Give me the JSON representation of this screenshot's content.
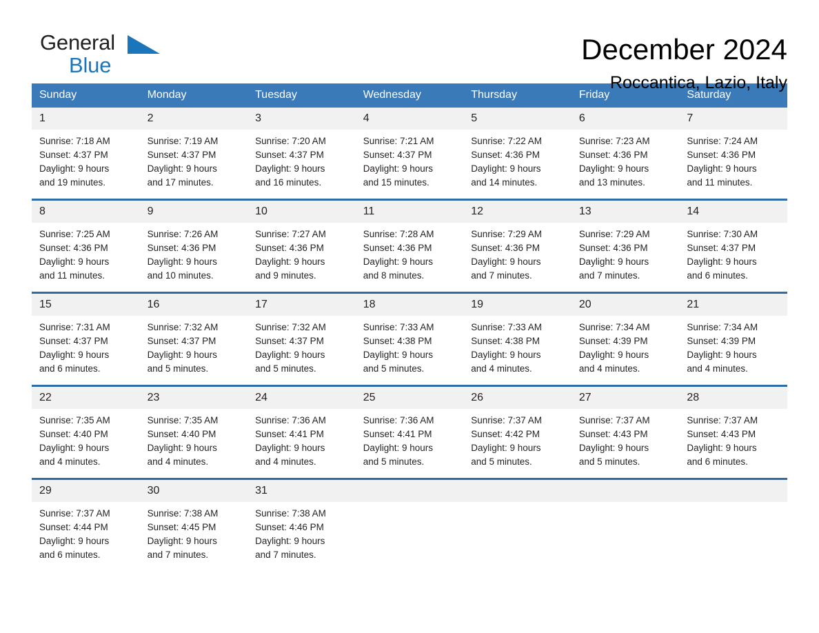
{
  "brand": {
    "name_part1": "General",
    "name_part2": "Blue",
    "triangle_color": "#1b75bb"
  },
  "header": {
    "title": "December 2024",
    "subtitle": "Roccantica, Lazio, Italy"
  },
  "theme": {
    "header_bg": "#3a7ab8",
    "rule_color": "#2b6ca9",
    "daynum_bg": "#f1f1f1",
    "text_color": "#231f20"
  },
  "weekdays": [
    "Sunday",
    "Monday",
    "Tuesday",
    "Wednesday",
    "Thursday",
    "Friday",
    "Saturday"
  ],
  "weeks": [
    [
      {
        "day": "1",
        "sunrise": "Sunrise: 7:18 AM",
        "sunset": "Sunset: 4:37 PM",
        "daylight1": "Daylight: 9 hours",
        "daylight2": "and 19 minutes."
      },
      {
        "day": "2",
        "sunrise": "Sunrise: 7:19 AM",
        "sunset": "Sunset: 4:37 PM",
        "daylight1": "Daylight: 9 hours",
        "daylight2": "and 17 minutes."
      },
      {
        "day": "3",
        "sunrise": "Sunrise: 7:20 AM",
        "sunset": "Sunset: 4:37 PM",
        "daylight1": "Daylight: 9 hours",
        "daylight2": "and 16 minutes."
      },
      {
        "day": "4",
        "sunrise": "Sunrise: 7:21 AM",
        "sunset": "Sunset: 4:37 PM",
        "daylight1": "Daylight: 9 hours",
        "daylight2": "and 15 minutes."
      },
      {
        "day": "5",
        "sunrise": "Sunrise: 7:22 AM",
        "sunset": "Sunset: 4:36 PM",
        "daylight1": "Daylight: 9 hours",
        "daylight2": "and 14 minutes."
      },
      {
        "day": "6",
        "sunrise": "Sunrise: 7:23 AM",
        "sunset": "Sunset: 4:36 PM",
        "daylight1": "Daylight: 9 hours",
        "daylight2": "and 13 minutes."
      },
      {
        "day": "7",
        "sunrise": "Sunrise: 7:24 AM",
        "sunset": "Sunset: 4:36 PM",
        "daylight1": "Daylight: 9 hours",
        "daylight2": "and 11 minutes."
      }
    ],
    [
      {
        "day": "8",
        "sunrise": "Sunrise: 7:25 AM",
        "sunset": "Sunset: 4:36 PM",
        "daylight1": "Daylight: 9 hours",
        "daylight2": "and 11 minutes."
      },
      {
        "day": "9",
        "sunrise": "Sunrise: 7:26 AM",
        "sunset": "Sunset: 4:36 PM",
        "daylight1": "Daylight: 9 hours",
        "daylight2": "and 10 minutes."
      },
      {
        "day": "10",
        "sunrise": "Sunrise: 7:27 AM",
        "sunset": "Sunset: 4:36 PM",
        "daylight1": "Daylight: 9 hours",
        "daylight2": "and 9 minutes."
      },
      {
        "day": "11",
        "sunrise": "Sunrise: 7:28 AM",
        "sunset": "Sunset: 4:36 PM",
        "daylight1": "Daylight: 9 hours",
        "daylight2": "and 8 minutes."
      },
      {
        "day": "12",
        "sunrise": "Sunrise: 7:29 AM",
        "sunset": "Sunset: 4:36 PM",
        "daylight1": "Daylight: 9 hours",
        "daylight2": "and 7 minutes."
      },
      {
        "day": "13",
        "sunrise": "Sunrise: 7:29 AM",
        "sunset": "Sunset: 4:36 PM",
        "daylight1": "Daylight: 9 hours",
        "daylight2": "and 7 minutes."
      },
      {
        "day": "14",
        "sunrise": "Sunrise: 7:30 AM",
        "sunset": "Sunset: 4:37 PM",
        "daylight1": "Daylight: 9 hours",
        "daylight2": "and 6 minutes."
      }
    ],
    [
      {
        "day": "15",
        "sunrise": "Sunrise: 7:31 AM",
        "sunset": "Sunset: 4:37 PM",
        "daylight1": "Daylight: 9 hours",
        "daylight2": "and 6 minutes."
      },
      {
        "day": "16",
        "sunrise": "Sunrise: 7:32 AM",
        "sunset": "Sunset: 4:37 PM",
        "daylight1": "Daylight: 9 hours",
        "daylight2": "and 5 minutes."
      },
      {
        "day": "17",
        "sunrise": "Sunrise: 7:32 AM",
        "sunset": "Sunset: 4:37 PM",
        "daylight1": "Daylight: 9 hours",
        "daylight2": "and 5 minutes."
      },
      {
        "day": "18",
        "sunrise": "Sunrise: 7:33 AM",
        "sunset": "Sunset: 4:38 PM",
        "daylight1": "Daylight: 9 hours",
        "daylight2": "and 5 minutes."
      },
      {
        "day": "19",
        "sunrise": "Sunrise: 7:33 AM",
        "sunset": "Sunset: 4:38 PM",
        "daylight1": "Daylight: 9 hours",
        "daylight2": "and 4 minutes."
      },
      {
        "day": "20",
        "sunrise": "Sunrise: 7:34 AM",
        "sunset": "Sunset: 4:39 PM",
        "daylight1": "Daylight: 9 hours",
        "daylight2": "and 4 minutes."
      },
      {
        "day": "21",
        "sunrise": "Sunrise: 7:34 AM",
        "sunset": "Sunset: 4:39 PM",
        "daylight1": "Daylight: 9 hours",
        "daylight2": "and 4 minutes."
      }
    ],
    [
      {
        "day": "22",
        "sunrise": "Sunrise: 7:35 AM",
        "sunset": "Sunset: 4:40 PM",
        "daylight1": "Daylight: 9 hours",
        "daylight2": "and 4 minutes."
      },
      {
        "day": "23",
        "sunrise": "Sunrise: 7:35 AM",
        "sunset": "Sunset: 4:40 PM",
        "daylight1": "Daylight: 9 hours",
        "daylight2": "and 4 minutes."
      },
      {
        "day": "24",
        "sunrise": "Sunrise: 7:36 AM",
        "sunset": "Sunset: 4:41 PM",
        "daylight1": "Daylight: 9 hours",
        "daylight2": "and 4 minutes."
      },
      {
        "day": "25",
        "sunrise": "Sunrise: 7:36 AM",
        "sunset": "Sunset: 4:41 PM",
        "daylight1": "Daylight: 9 hours",
        "daylight2": "and 5 minutes."
      },
      {
        "day": "26",
        "sunrise": "Sunrise: 7:37 AM",
        "sunset": "Sunset: 4:42 PM",
        "daylight1": "Daylight: 9 hours",
        "daylight2": "and 5 minutes."
      },
      {
        "day": "27",
        "sunrise": "Sunrise: 7:37 AM",
        "sunset": "Sunset: 4:43 PM",
        "daylight1": "Daylight: 9 hours",
        "daylight2": "and 5 minutes."
      },
      {
        "day": "28",
        "sunrise": "Sunrise: 7:37 AM",
        "sunset": "Sunset: 4:43 PM",
        "daylight1": "Daylight: 9 hours",
        "daylight2": "and 6 minutes."
      }
    ],
    [
      {
        "day": "29",
        "sunrise": "Sunrise: 7:37 AM",
        "sunset": "Sunset: 4:44 PM",
        "daylight1": "Daylight: 9 hours",
        "daylight2": "and 6 minutes."
      },
      {
        "day": "30",
        "sunrise": "Sunrise: 7:38 AM",
        "sunset": "Sunset: 4:45 PM",
        "daylight1": "Daylight: 9 hours",
        "daylight2": "and 7 minutes."
      },
      {
        "day": "31",
        "sunrise": "Sunrise: 7:38 AM",
        "sunset": "Sunset: 4:46 PM",
        "daylight1": "Daylight: 9 hours",
        "daylight2": "and 7 minutes."
      },
      {
        "day": "",
        "sunrise": "",
        "sunset": "",
        "daylight1": "",
        "daylight2": ""
      },
      {
        "day": "",
        "sunrise": "",
        "sunset": "",
        "daylight1": "",
        "daylight2": ""
      },
      {
        "day": "",
        "sunrise": "",
        "sunset": "",
        "daylight1": "",
        "daylight2": ""
      },
      {
        "day": "",
        "sunrise": "",
        "sunset": "",
        "daylight1": "",
        "daylight2": ""
      }
    ]
  ]
}
